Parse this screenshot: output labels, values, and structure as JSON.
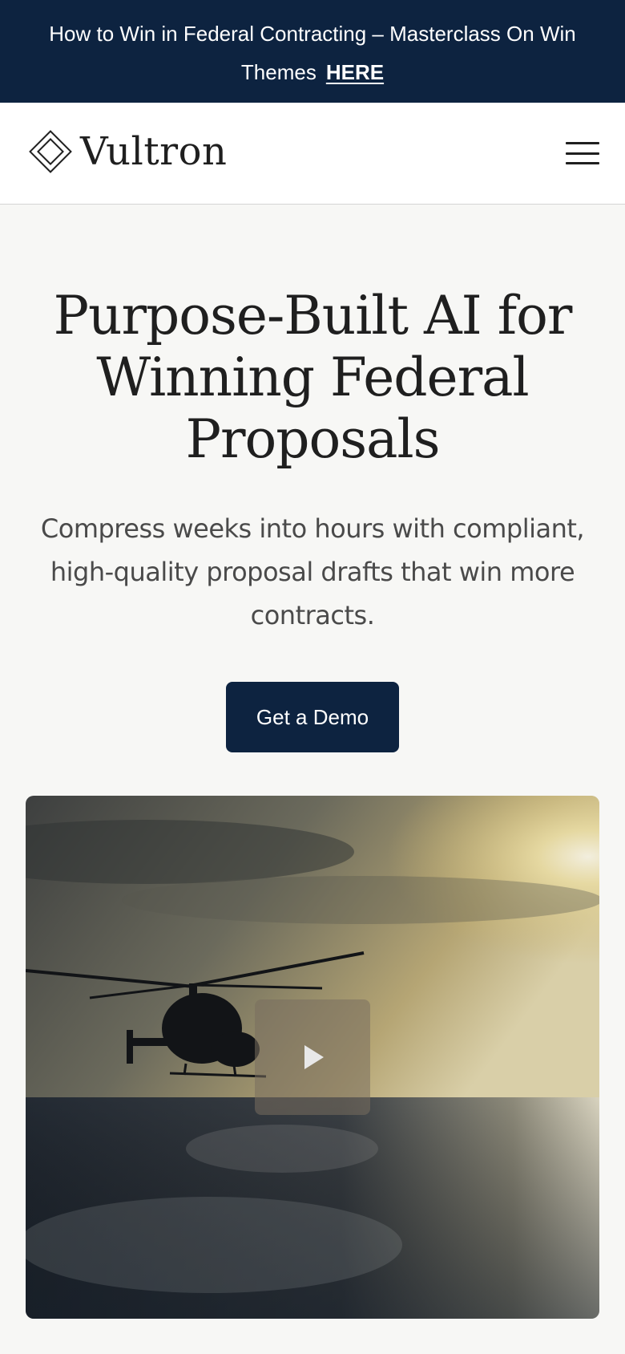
{
  "announcement": {
    "text": "How to Win in Federal Contracting – Masterclass On Win Themes",
    "link_label": "HERE"
  },
  "header": {
    "brand": "Vultron",
    "menu_icon": "hamburger-menu-icon"
  },
  "hero": {
    "title": "Purpose-Built AI for Winning Federal Proposals",
    "subtitle": "Compress weeks into hours with compliant, high-quality proposal drafts that win more contracts.",
    "cta_label": "Get a Demo"
  },
  "video": {
    "play_icon": "play-icon"
  },
  "colors": {
    "navy": "#0d2340",
    "background": "#f7f7f5",
    "text_dark": "#1f1f1f",
    "text_muted": "#4a4a4a"
  }
}
